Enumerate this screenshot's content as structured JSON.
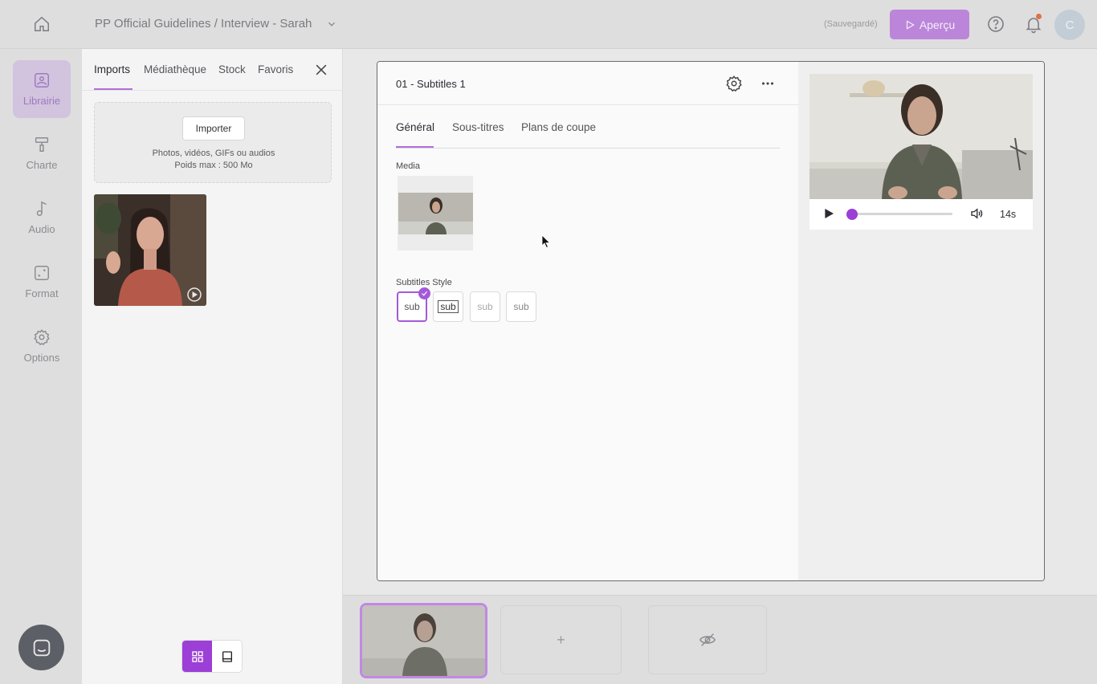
{
  "header": {
    "breadcrumb": "PP Official Guidelines / Interview - Sarah",
    "save_status": "(Sauvegardé)",
    "preview_label": "Aperçu",
    "avatar_initial": "C",
    "accent_color": "#9b3fd6"
  },
  "rail": {
    "items": [
      {
        "label": "Librairie",
        "icon": "library-icon"
      },
      {
        "label": "Charte",
        "icon": "paint-roller-icon"
      },
      {
        "label": "Audio",
        "icon": "music-note-icon"
      },
      {
        "label": "Format",
        "icon": "resize-icon"
      },
      {
        "label": "Options",
        "icon": "gear-icon"
      }
    ],
    "active": "Librairie"
  },
  "library": {
    "tabs": [
      "Imports",
      "Médiathèque",
      "Stock",
      "Favoris"
    ],
    "active_tab": "Imports",
    "import_button": "Importer",
    "hint_line1": "Photos, vidéos, GIFs ou audios",
    "hint_line2": "Poids max : 500 Mo"
  },
  "editor": {
    "title": "01 - Subtitles 1",
    "tabs": [
      "Général",
      "Sous-titres",
      "Plans de coupe"
    ],
    "active_tab": "Général",
    "media_label": "Media",
    "subtitles_style_label": "Subtitles Style",
    "style_options": [
      "sub",
      "sub",
      "sub",
      "sub"
    ],
    "selected_style_index": 0
  },
  "player": {
    "duration": "14s",
    "progress": 0.0
  },
  "timeline": {
    "add_symbol": "+"
  }
}
